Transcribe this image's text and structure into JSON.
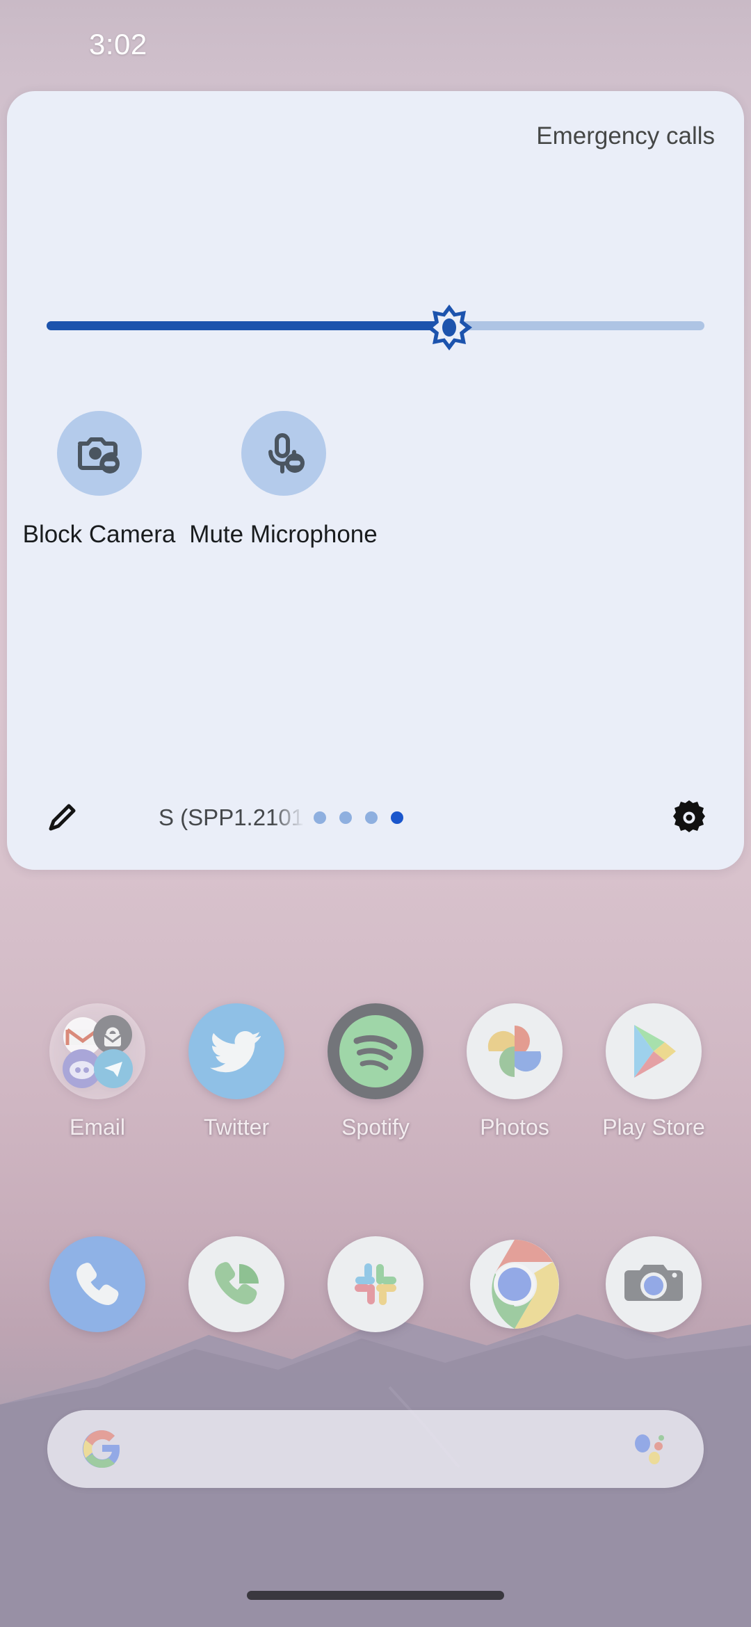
{
  "status_bar": {
    "clock": "3:02"
  },
  "quick_settings": {
    "emergency_calls_label": "Emergency calls",
    "brightness": {
      "name": "brightness-slider",
      "value_percent": 60,
      "icon": "brightness-sun-icon"
    },
    "tiles": [
      {
        "label": "Block Camera",
        "icon": "camera-block-icon",
        "state": "off"
      },
      {
        "label": "Mute Microphone",
        "icon": "microphone-mute-icon",
        "state": "off"
      }
    ],
    "footer": {
      "edit_icon": "pencil-edit-icon",
      "build_text": "S (SPP1.2101",
      "settings_icon": "gear-settings-icon",
      "page_dots": {
        "count": 4,
        "active_index": 3
      }
    }
  },
  "home_screen": {
    "app_row": [
      {
        "label": "Email",
        "icon": "email-folder-icon"
      },
      {
        "label": "Twitter",
        "icon": "twitter-icon"
      },
      {
        "label": "Spotify",
        "icon": "spotify-icon"
      },
      {
        "label": "Photos",
        "icon": "google-photos-icon"
      },
      {
        "label": "Play Store",
        "icon": "play-store-icon"
      }
    ],
    "dock": [
      {
        "label": "",
        "icon": "phone-dialer-icon"
      },
      {
        "label": "",
        "icon": "google-voice-icon"
      },
      {
        "label": "",
        "icon": "slack-icon"
      },
      {
        "label": "",
        "icon": "chrome-icon"
      },
      {
        "label": "",
        "icon": "camera-icon"
      }
    ],
    "search_bar": {
      "placeholder": "",
      "value": "",
      "left_icon": "google-g-icon",
      "right_icon": "google-assistant-icon"
    }
  },
  "navigation": {
    "handle": "gesture-nav-handle"
  },
  "colors": {
    "panel_bg": "#eaeef8",
    "tile_bg": "#b4cbeb",
    "slider_active": "#1c53ad",
    "slider_inactive": "#aec4e4",
    "accent_dot": "#1a56cc",
    "icon_fg": "#4a5560"
  }
}
